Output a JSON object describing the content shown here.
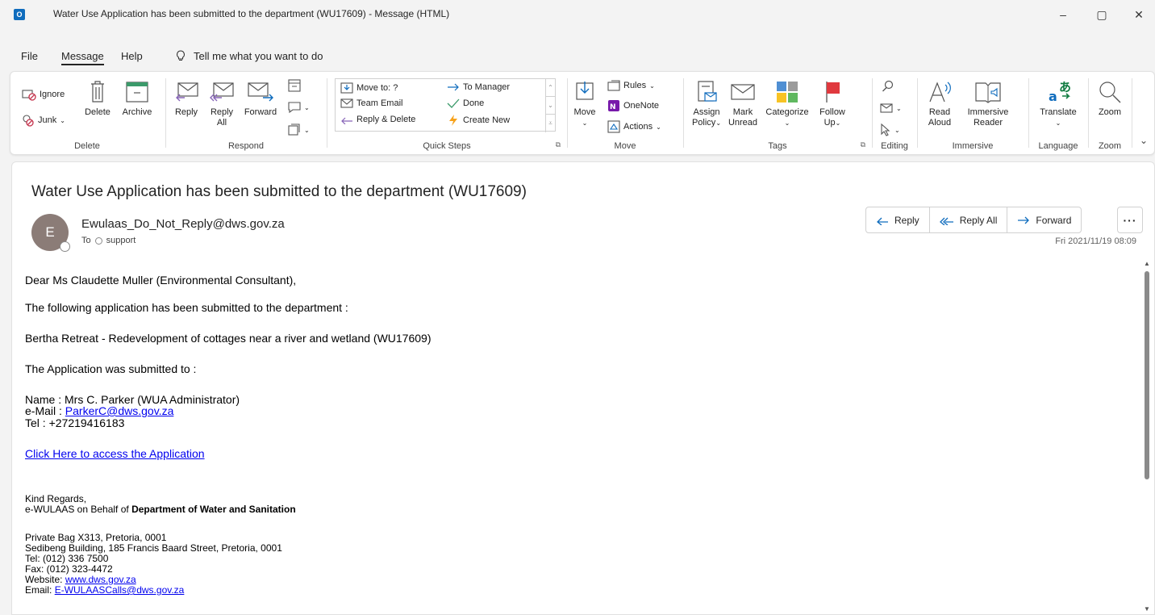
{
  "window": {
    "app_icon": "O",
    "title": "Water Use Application has been submitted to the department (WU17609)  -  Message (HTML)",
    "minimize": "–",
    "restore": "▢",
    "close": "✕"
  },
  "menu": {
    "items": [
      "File",
      "Message",
      "Help"
    ],
    "tell_me": "Tell me what you want to do"
  },
  "ribbon": {
    "delete": {
      "label": "Delete",
      "ignore": "Ignore",
      "junk": "Junk",
      "delete_btn": "Delete",
      "archive": "Archive"
    },
    "respond": {
      "label": "Respond",
      "reply": "Reply",
      "reply_all_1": "Reply",
      "reply_all_2": "All",
      "forward": "Forward"
    },
    "quick_steps": {
      "label": "Quick Steps",
      "items": [
        "Move to: ?",
        "To Manager",
        "Team Email",
        "Done",
        "Reply & Delete",
        "Create New"
      ]
    },
    "move": {
      "label": "Move",
      "move_btn": "Move",
      "rules": "Rules",
      "onenote": "OneNote",
      "actions": "Actions"
    },
    "tags": {
      "label": "Tags",
      "assign_1": "Assign",
      "assign_2": "Policy",
      "mark_1": "Mark",
      "mark_2": "Unread",
      "categorize": "Categorize",
      "follow_1": "Follow",
      "follow_2": "Up"
    },
    "editing": {
      "label": "Editing"
    },
    "immersive": {
      "label": "Immersive",
      "read_1": "Read",
      "read_2": "Aloud",
      "imm_1": "Immersive",
      "imm_2": "Reader"
    },
    "language": {
      "label": "Language",
      "translate": "Translate"
    },
    "zoom": {
      "label": "Zoom",
      "zoom_btn": "Zoom"
    }
  },
  "message": {
    "subject": "Water Use Application has been submitted to the department (WU17609)",
    "avatar_initial": "E",
    "sender": "Ewulaas_Do_Not_Reply@dws.gov.za",
    "to_label": "To",
    "to_name": "support",
    "date": "Fri 2021/11/19 08:09",
    "actions": {
      "reply": "Reply",
      "reply_all": "Reply All",
      "forward": "Forward",
      "more": "···"
    }
  },
  "body": {
    "greeting": "Dear Ms Claudette Muller (Environmental Consultant),",
    "line1": "The following application has been submitted to the department :",
    "line2": "Bertha Retreat - Redevelopment of cottages near a river and wetland (WU17609)",
    "line3": "The Application was submitted to :",
    "name": "Name : Mrs C. Parker (WUA Administrator)",
    "email_label": "e-Mail : ",
    "email": "ParkerC@dws.gov.za",
    "tel": "Tel : +27219416183",
    "access_link": "Click Here to access the Application",
    "regards": "Kind Regards,",
    "behalf_prefix": "e-WULAAS on Behalf of ",
    "behalf_org": "Department of Water and Sanitation",
    "addr1": "Private Bag X313, Pretoria, 0001",
    "addr2": "Sedibeng Building, 185 Francis Baard Street, Pretoria, 0001",
    "tel2": "Tel: (012) 336 7500",
    "fax": "Fax: (012) 323-4472",
    "website_label": "Website: ",
    "website": "www.dws.gov.za",
    "email2_label": "Email: ",
    "email2": "E-WULAASCalls@dws.gov.za"
  }
}
